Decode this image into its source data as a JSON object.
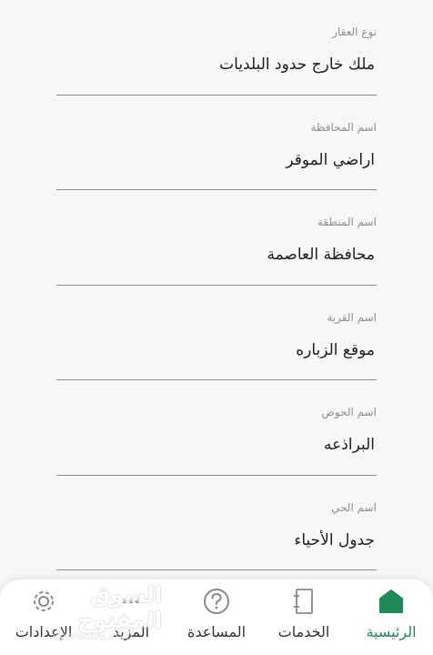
{
  "form": {
    "fields": [
      {
        "label": "نوع العقار",
        "value": "ملك خارج حدود البلديات"
      },
      {
        "label": "اسم المحافظة",
        "value": "اراضي الموقر"
      },
      {
        "label": "اسم المنطقة",
        "value": "محافظة العاصمة"
      },
      {
        "label": "اسم القرية",
        "value": "موقع الزباره"
      },
      {
        "label": "اسم الحوض",
        "value": "البراذعه"
      },
      {
        "label": "اسم الحي",
        "value": "جدول الأحياء"
      }
    ]
  },
  "tabbar": {
    "active_color": "#1f8a55",
    "tabs": [
      {
        "label": "الرئيسية",
        "icon": "home-icon",
        "active": true
      },
      {
        "label": "الخدمات",
        "icon": "services-icon",
        "active": false
      },
      {
        "label": "المساعدة",
        "icon": "help-icon",
        "active": false
      },
      {
        "label": "المزيد",
        "icon": "more-icon",
        "active": false
      },
      {
        "label": "الإعدادات",
        "icon": "settings-icon",
        "active": false
      }
    ]
  },
  "watermark": {
    "arabic": "السوق المفتوح",
    "latin": "opensooq.com"
  }
}
